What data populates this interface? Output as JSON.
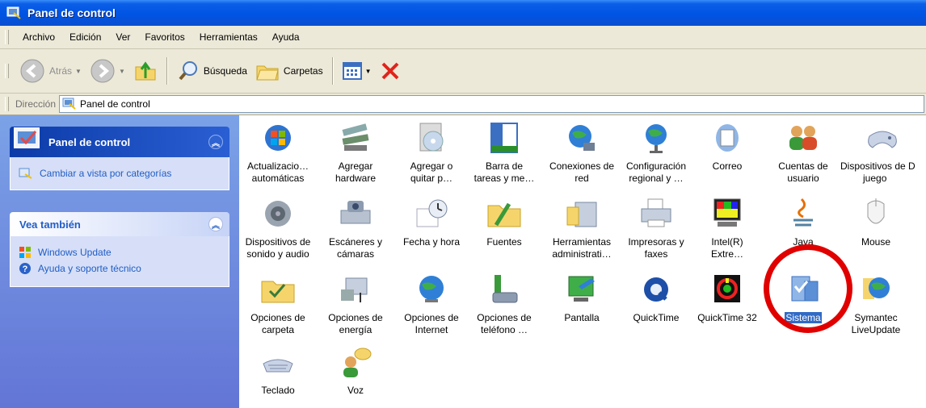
{
  "window": {
    "title": "Panel de control"
  },
  "menu": [
    "Archivo",
    "Edición",
    "Ver",
    "Favoritos",
    "Herramientas",
    "Ayuda"
  ],
  "toolbar": {
    "back": "Atrás",
    "search": "Búsqueda",
    "folders": "Carpetas"
  },
  "address": {
    "label": "Dirección",
    "value": "Panel de control"
  },
  "sidebar": {
    "panel1": {
      "title": "Panel de control",
      "task": "Cambiar a vista por categorías"
    },
    "panel2": {
      "title": "Vea también",
      "links": [
        "Windows Update",
        "Ayuda y soporte técnico"
      ]
    }
  },
  "items": [
    {
      "l1": "Actualizacio…",
      "l2": "automáticas",
      "icon": "automatic-updates-icon"
    },
    {
      "l1": "Agregar",
      "l2": "hardware",
      "icon": "add-hardware-icon"
    },
    {
      "l1": "Agregar o",
      "l2": "quitar p…",
      "icon": "add-remove-programs-icon"
    },
    {
      "l1": "Barra de",
      "l2": "tareas y me…",
      "icon": "taskbar-icon"
    },
    {
      "l1": "Conexiones de",
      "l2": "red",
      "icon": "network-connections-icon"
    },
    {
      "l1": "Configuración",
      "l2": "regional y …",
      "icon": "regional-settings-icon"
    },
    {
      "l1": "Correo",
      "l2": "",
      "icon": "mail-icon"
    },
    {
      "l1": "Cuentas de",
      "l2": "usuario",
      "icon": "user-accounts-icon"
    },
    {
      "l1": "Dispositivos de D",
      "l2": "juego",
      "icon": "game-controllers-icon"
    },
    {
      "l1": "Dispositivos de",
      "l2": "sonido y audio",
      "icon": "sound-audio-icon"
    },
    {
      "l1": "Escáneres y",
      "l2": "cámaras",
      "icon": "scanners-cameras-icon"
    },
    {
      "l1": "Fecha y hora",
      "l2": "",
      "icon": "date-time-icon"
    },
    {
      "l1": "Fuentes",
      "l2": "",
      "icon": "fonts-folder-icon"
    },
    {
      "l1": "Herramientas",
      "l2": "administrati…",
      "icon": "admin-tools-icon"
    },
    {
      "l1": "Impresoras y",
      "l2": "faxes",
      "icon": "printers-faxes-icon"
    },
    {
      "l1": "Intel(R)",
      "l2": "Extre…",
      "icon": "intel-graphics-icon"
    },
    {
      "l1": "Java",
      "l2": "",
      "icon": "java-icon"
    },
    {
      "l1": "Mouse",
      "l2": "",
      "icon": "mouse-icon"
    },
    {
      "l1": "Opciones de",
      "l2": "carpeta",
      "icon": "folder-options-icon"
    },
    {
      "l1": "Opciones de",
      "l2": "energía",
      "icon": "power-options-icon"
    },
    {
      "l1": "Opciones de",
      "l2": "Internet",
      "icon": "internet-options-icon"
    },
    {
      "l1": "Opciones de",
      "l2": "teléfono …",
      "icon": "phone-modem-icon"
    },
    {
      "l1": "Pantalla",
      "l2": "",
      "icon": "display-icon"
    },
    {
      "l1": "QuickTime",
      "l2": "",
      "icon": "quicktime-icon"
    },
    {
      "l1": "QuickTime 32",
      "l2": "",
      "icon": "quicktime32-icon"
    },
    {
      "l1": "Sistema",
      "l2": "",
      "icon": "system-icon",
      "selected": true
    },
    {
      "l1": "Symantec",
      "l2": "LiveUpdate",
      "icon": "symantec-liveupdate-icon"
    },
    {
      "l1": "Teclado",
      "l2": "",
      "icon": "keyboard-icon"
    },
    {
      "l1": "Voz",
      "l2": "",
      "icon": "speech-icon"
    }
  ],
  "colors": {
    "title_bar": "#0054e3",
    "task_pane": "#7ba2e7",
    "highlight": "#e10000",
    "selection": "#316ac5"
  }
}
